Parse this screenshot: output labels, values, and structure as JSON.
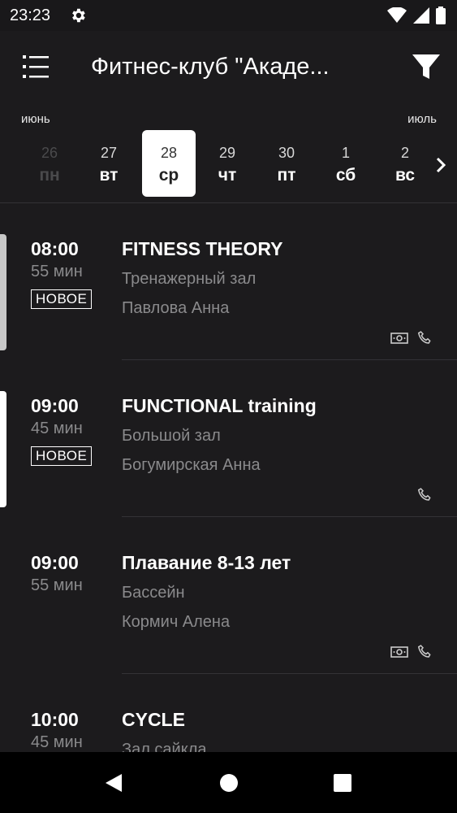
{
  "status_bar": {
    "time": "23:23"
  },
  "header": {
    "title": "Фитнес-клуб \"Акаде..."
  },
  "calendar": {
    "month_left": "июнь",
    "month_right": "июль",
    "days": [
      {
        "num": "26",
        "wd": "пн"
      },
      {
        "num": "27",
        "wd": "вт"
      },
      {
        "num": "28",
        "wd": "ср"
      },
      {
        "num": "29",
        "wd": "чт"
      },
      {
        "num": "30",
        "wd": "пт"
      },
      {
        "num": "1",
        "wd": "сб"
      },
      {
        "num": "2",
        "wd": "вс"
      }
    ],
    "selected_day": "28"
  },
  "sessions": [
    {
      "time": "08:00",
      "duration": "55 мин",
      "badge": "НОВОЕ",
      "name": "FITNESS THEORY",
      "room": "Тренажерный зал",
      "trainer": "Павлова Анна",
      "icons": [
        "money-icon",
        "phone-icon"
      ],
      "marker_color": "#c8c8c8"
    },
    {
      "time": "09:00",
      "duration": "45 мин",
      "badge": "НОВОЕ",
      "name": "FUNCTIONAL training",
      "room": "Большой зал",
      "trainer": "Богумирская Анна",
      "icons": [
        "phone-icon"
      ],
      "marker_color": "#ffffff"
    },
    {
      "time": "09:00",
      "duration": "55 мин",
      "name": "Плавание 8-13 лет",
      "room": "Бассейн",
      "trainer": "Кормич Алена",
      "icons": [
        "money-icon",
        "phone-icon"
      ]
    },
    {
      "time": "10:00",
      "duration": "45 мин",
      "name": "CYCLE",
      "room": "Зал сайкла"
    }
  ],
  "colors": {
    "background": "#1c1b1d",
    "secondary_text": "#8a8a8c",
    "selected_day_bg": "#ffffff",
    "nav_bar": "#000000"
  }
}
